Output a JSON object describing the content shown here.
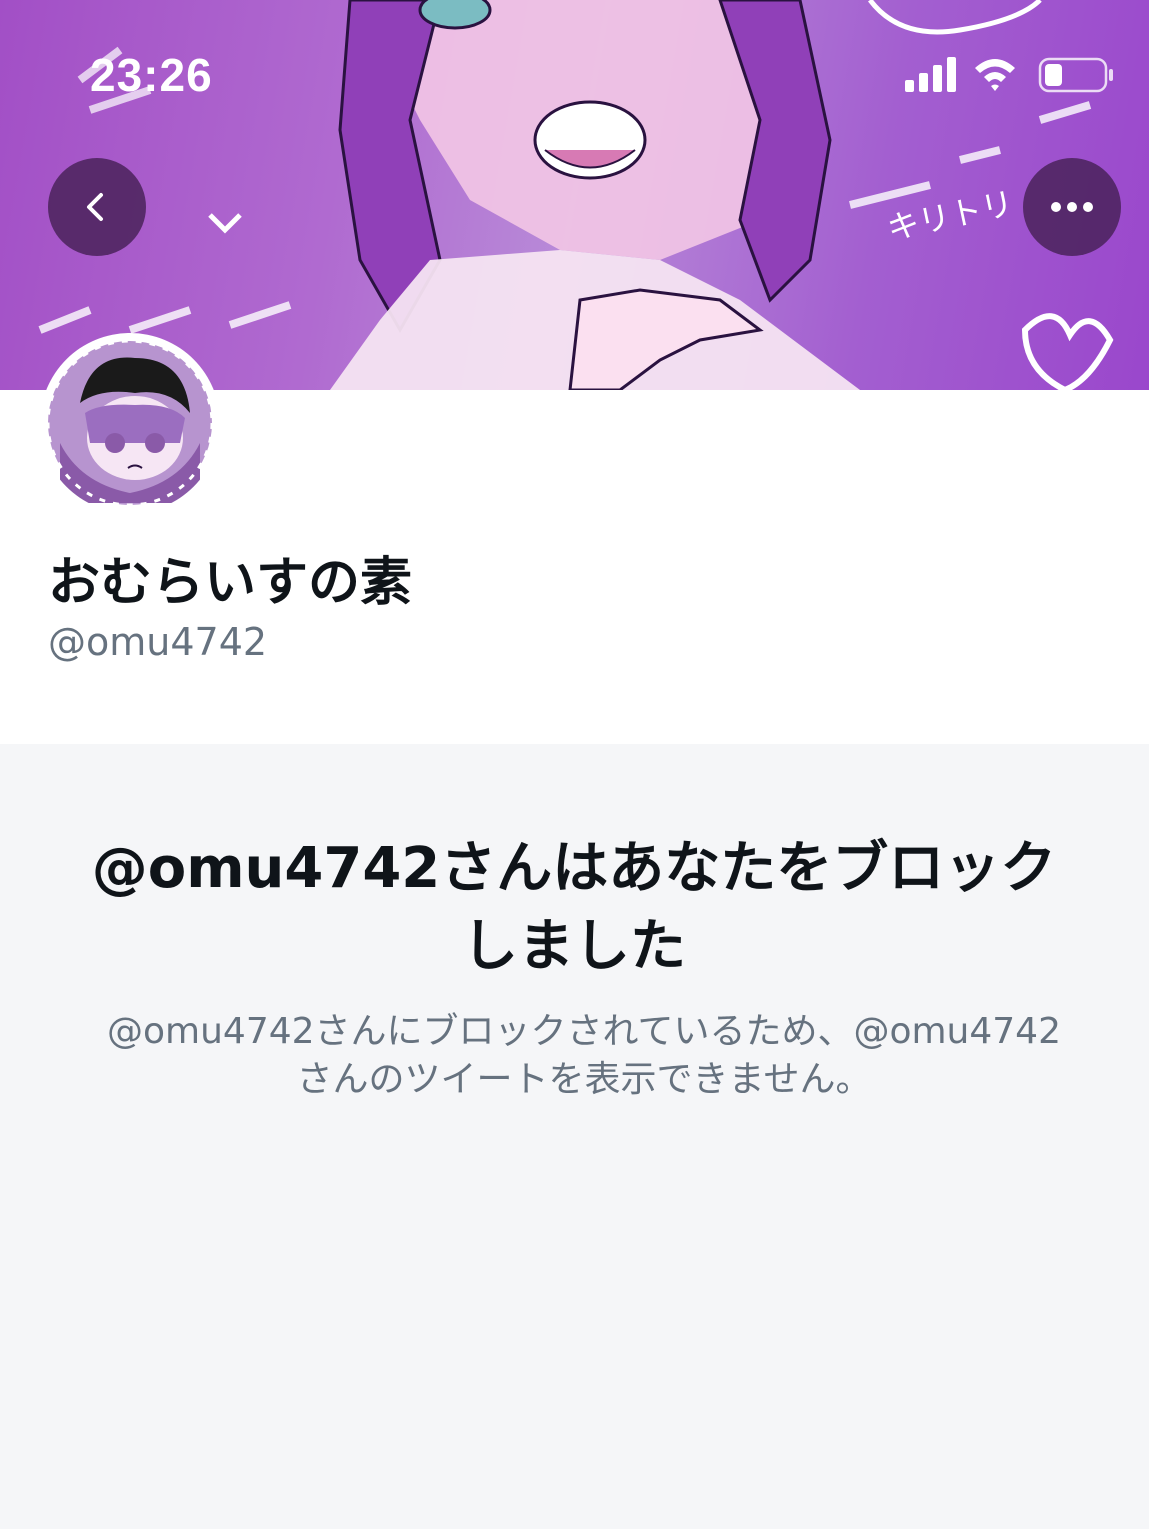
{
  "status_bar": {
    "time": "23:26",
    "signal_icon": "cellular-signal-icon",
    "wifi_icon": "wifi-icon",
    "battery_icon": "battery-icon",
    "battery_level": 0.3
  },
  "header": {
    "back_icon": "chevron-left-icon",
    "more_icon": "more-horizontal-icon",
    "banner_text": "キリトリ"
  },
  "profile": {
    "display_name": "おむらいすの素",
    "handle": "@omu4742"
  },
  "blocked": {
    "title_line1": "@omu4742さんはあなたをブロック",
    "title_line2": "しました",
    "desc_line1": "@omu4742さんにブロックされているため、@omu4742",
    "desc_line2": "さんのツイートを表示できません。"
  },
  "colors": {
    "banner_purple": "#a24fc6",
    "button_bg": "#4a225a",
    "text_primary": "#0f1419",
    "text_secondary": "#66727f",
    "background_gray": "#f5f6f8"
  }
}
